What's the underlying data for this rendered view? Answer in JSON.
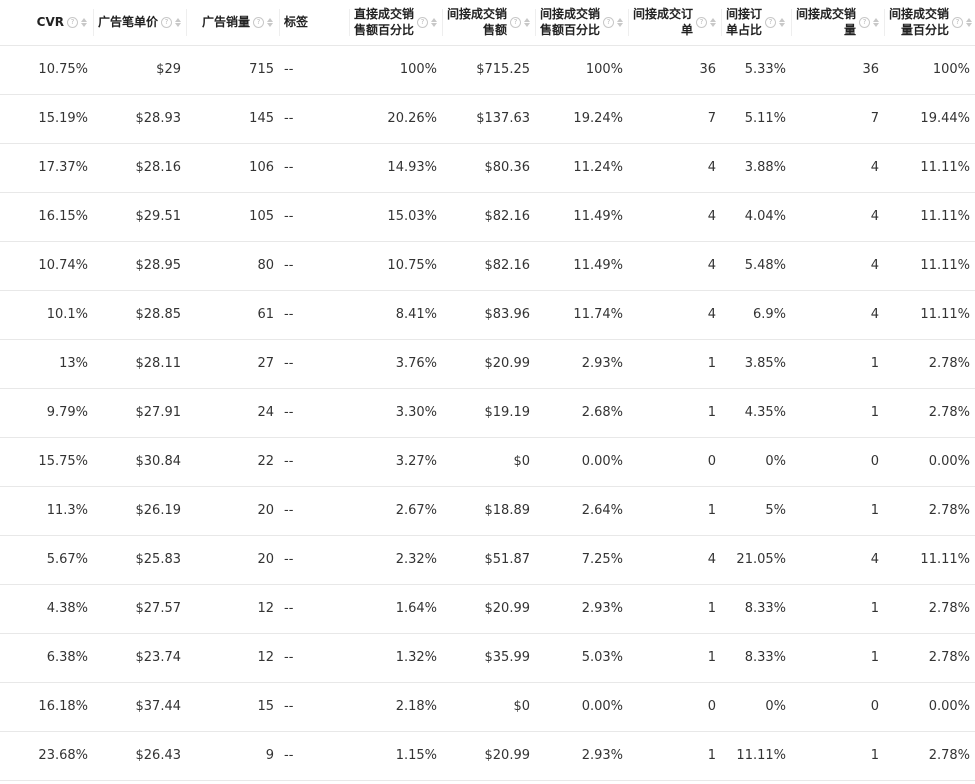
{
  "columns": [
    {
      "key": "cvr",
      "label": "CVR"
    },
    {
      "key": "ad_unit_price",
      "label": "广告笔单价"
    },
    {
      "key": "ad_sales_qty",
      "label": "广告销量"
    },
    {
      "key": "tags",
      "label": "标签"
    },
    {
      "key": "direct_sales_pct",
      "label": "直接成交销售额百分比"
    },
    {
      "key": "indirect_sales",
      "label": "间接成交销售额"
    },
    {
      "key": "indirect_sales_pct",
      "label": "间接成交销售额百分比"
    },
    {
      "key": "indirect_orders",
      "label": "间接成交订单"
    },
    {
      "key": "indirect_order_share",
      "label": "间接订单占比"
    },
    {
      "key": "indirect_qty",
      "label": "间接成交销量"
    },
    {
      "key": "indirect_qty_pct",
      "label": "间接成交销量百分比"
    }
  ],
  "rows": [
    [
      "10.75%",
      "$29",
      "715",
      "--",
      "100%",
      "$715.25",
      "100%",
      "36",
      "5.33%",
      "36",
      "100%"
    ],
    [
      "15.19%",
      "$28.93",
      "145",
      "--",
      "20.26%",
      "$137.63",
      "19.24%",
      "7",
      "5.11%",
      "7",
      "19.44%"
    ],
    [
      "17.37%",
      "$28.16",
      "106",
      "--",
      "14.93%",
      "$80.36",
      "11.24%",
      "4",
      "3.88%",
      "4",
      "11.11%"
    ],
    [
      "16.15%",
      "$29.51",
      "105",
      "--",
      "15.03%",
      "$82.16",
      "11.49%",
      "4",
      "4.04%",
      "4",
      "11.11%"
    ],
    [
      "10.74%",
      "$28.95",
      "80",
      "--",
      "10.75%",
      "$82.16",
      "11.49%",
      "4",
      "5.48%",
      "4",
      "11.11%"
    ],
    [
      "10.1%",
      "$28.85",
      "61",
      "--",
      "8.41%",
      "$83.96",
      "11.74%",
      "4",
      "6.9%",
      "4",
      "11.11%"
    ],
    [
      "13%",
      "$28.11",
      "27",
      "--",
      "3.76%",
      "$20.99",
      "2.93%",
      "1",
      "3.85%",
      "1",
      "2.78%"
    ],
    [
      "9.79%",
      "$27.91",
      "24",
      "--",
      "3.30%",
      "$19.19",
      "2.68%",
      "1",
      "4.35%",
      "1",
      "2.78%"
    ],
    [
      "15.75%",
      "$30.84",
      "22",
      "--",
      "3.27%",
      "$0",
      "0.00%",
      "0",
      "0%",
      "0",
      "0.00%"
    ],
    [
      "11.3%",
      "$26.19",
      "20",
      "--",
      "2.67%",
      "$18.89",
      "2.64%",
      "1",
      "5%",
      "1",
      "2.78%"
    ],
    [
      "5.67%",
      "$25.83",
      "20",
      "--",
      "2.32%",
      "$51.87",
      "7.25%",
      "4",
      "21.05%",
      "4",
      "11.11%"
    ],
    [
      "4.38%",
      "$27.57",
      "12",
      "--",
      "1.64%",
      "$20.99",
      "2.93%",
      "1",
      "8.33%",
      "1",
      "2.78%"
    ],
    [
      "6.38%",
      "$23.74",
      "12",
      "--",
      "1.32%",
      "$35.99",
      "5.03%",
      "1",
      "8.33%",
      "1",
      "2.78%"
    ],
    [
      "16.18%",
      "$37.44",
      "15",
      "--",
      "2.18%",
      "$0",
      "0.00%",
      "0",
      "0%",
      "0",
      "0.00%"
    ],
    [
      "23.68%",
      "$26.43",
      "9",
      "--",
      "1.15%",
      "$20.99",
      "2.93%",
      "1",
      "11.11%",
      "1",
      "2.78%"
    ]
  ]
}
